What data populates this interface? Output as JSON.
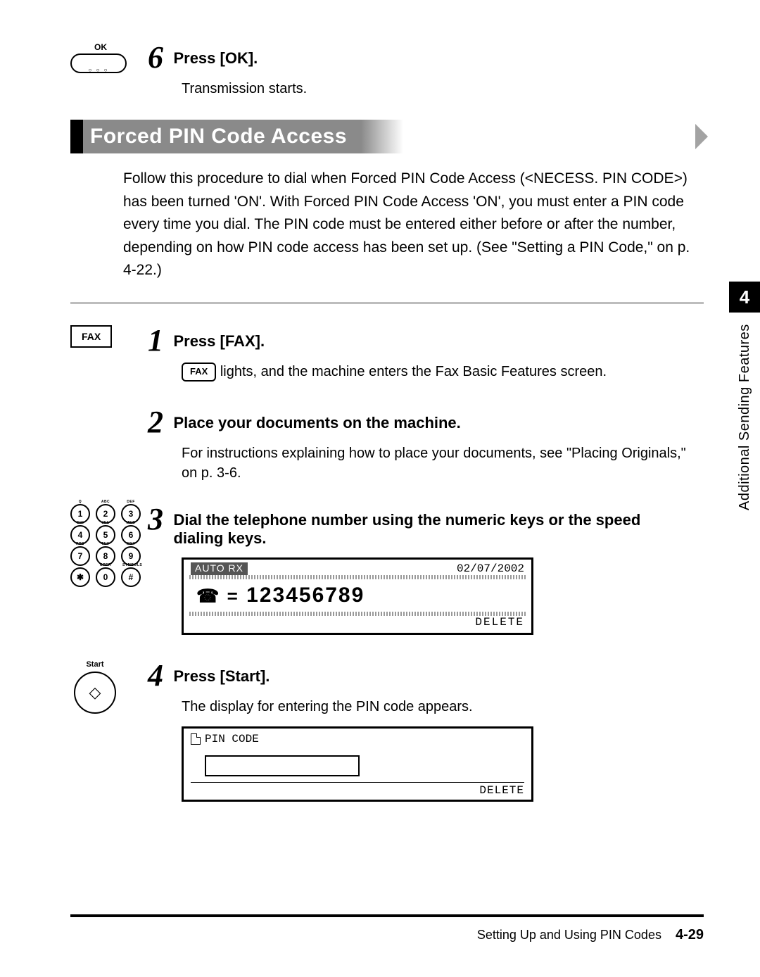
{
  "step6": {
    "ok_label": "OK",
    "num": "6",
    "heading": "Press [OK].",
    "body": "Transmission starts."
  },
  "section": {
    "title": "Forced PIN Code Access",
    "intro": "Follow this procedure to dial when Forced PIN Code Access (<NECESS. PIN CODE>) has been turned 'ON'. With Forced PIN Code Access 'ON', you must enter a PIN code every time you dial. The PIN code must be entered either before or after the number, depending on how PIN code access has been set up. (See \"Setting a PIN Code,\" on p. 4-22.)"
  },
  "side": {
    "chapter": "4",
    "label": "Additional Sending Features"
  },
  "step1": {
    "chip": "FAX",
    "num": "1",
    "heading": "Press [FAX].",
    "inline_chip": "FAX",
    "body_after": " lights, and the machine enters the Fax Basic Features screen."
  },
  "step2": {
    "num": "2",
    "heading": "Place your documents on the machine.",
    "body": "For instructions explaining how to place your documents, see \"Placing Originals,\" on p. 3-6."
  },
  "step3": {
    "num": "3",
    "heading": "Dial the telephone number using the numeric keys or the speed dialing keys.",
    "lcd": {
      "mode": "AUTO RX",
      "date": "02/07/2002",
      "prefix": "☎ =",
      "number": "123456789",
      "delete": "DELETE"
    },
    "keypad_sup": {
      "r1": [
        "Q",
        "ABC",
        "DEF"
      ],
      "r2": [
        "GHI",
        "JKL",
        "MNO"
      ],
      "r3": [
        "PRS",
        "TUV",
        "WXY"
      ],
      "r4": [
        "",
        "OPER",
        "SYMBOLS"
      ]
    },
    "keypad": {
      "r1": [
        "1",
        "2",
        "3"
      ],
      "r2": [
        "4",
        "5",
        "6"
      ],
      "r3": [
        "7",
        "8",
        "9"
      ],
      "r4": [
        "✱",
        "0",
        "#"
      ]
    }
  },
  "step4": {
    "start_label": "Start",
    "num": "4",
    "heading": "Press [Start].",
    "body": "The display for entering the PIN code appears.",
    "lcd": {
      "title": "PIN CODE",
      "delete": "DELETE"
    }
  },
  "footer": {
    "section": "Setting Up and Using PIN Codes",
    "page": "4-29"
  }
}
